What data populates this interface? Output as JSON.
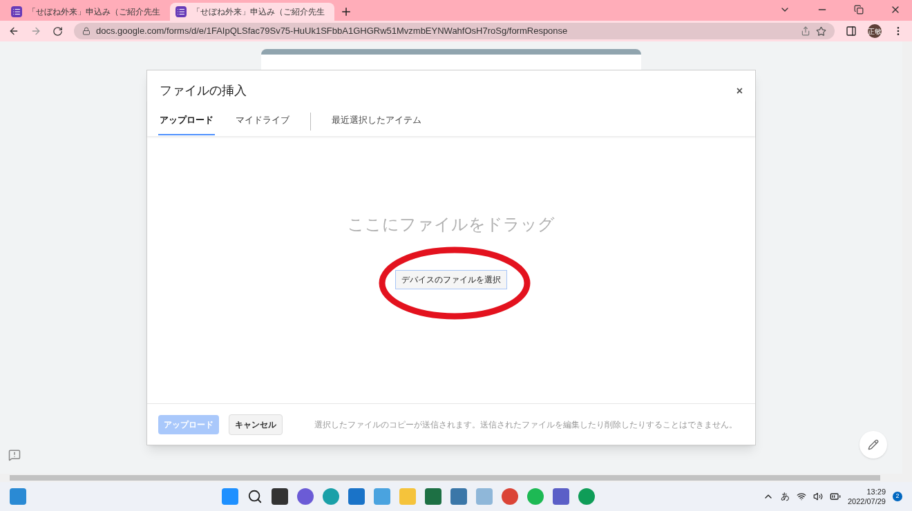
{
  "browser": {
    "tabs": [
      {
        "title": "「せぼね外来」申込み（ご紹介先生",
        "selected": false
      },
      {
        "title": "「せぼね外来」申込み（ご紹介先生",
        "selected": true
      }
    ],
    "url": "docs.google.com/forms/d/e/1FAIpQLSfac79Sv75-HuUk1SFbbA1GHGRw51MvzmbEYNWahfOsH7roSg/formResponse",
    "profile": "正敏"
  },
  "dialog": {
    "title": "ファイルの挿入",
    "close": "×",
    "tabs": [
      {
        "label": "アップロード",
        "selected": true
      },
      {
        "label": "マイドライブ",
        "selected": false
      },
      {
        "label": "最近選択したアイテム",
        "selected": false
      }
    ],
    "drop_hint": "ここにファイルをドラッグ",
    "select_button": "デバイスのファイルを選択",
    "upload_button": {
      "label": "アップロード",
      "disabled": true
    },
    "cancel_button": "キャンセル",
    "note": "選択したファイルのコピーが送信されます。送信されたファイルを編集したり削除したりすることはできません。"
  },
  "taskbar": {
    "ime": "あ",
    "time": "13:29",
    "date": "2022/07/29",
    "notifications": "2"
  }
}
